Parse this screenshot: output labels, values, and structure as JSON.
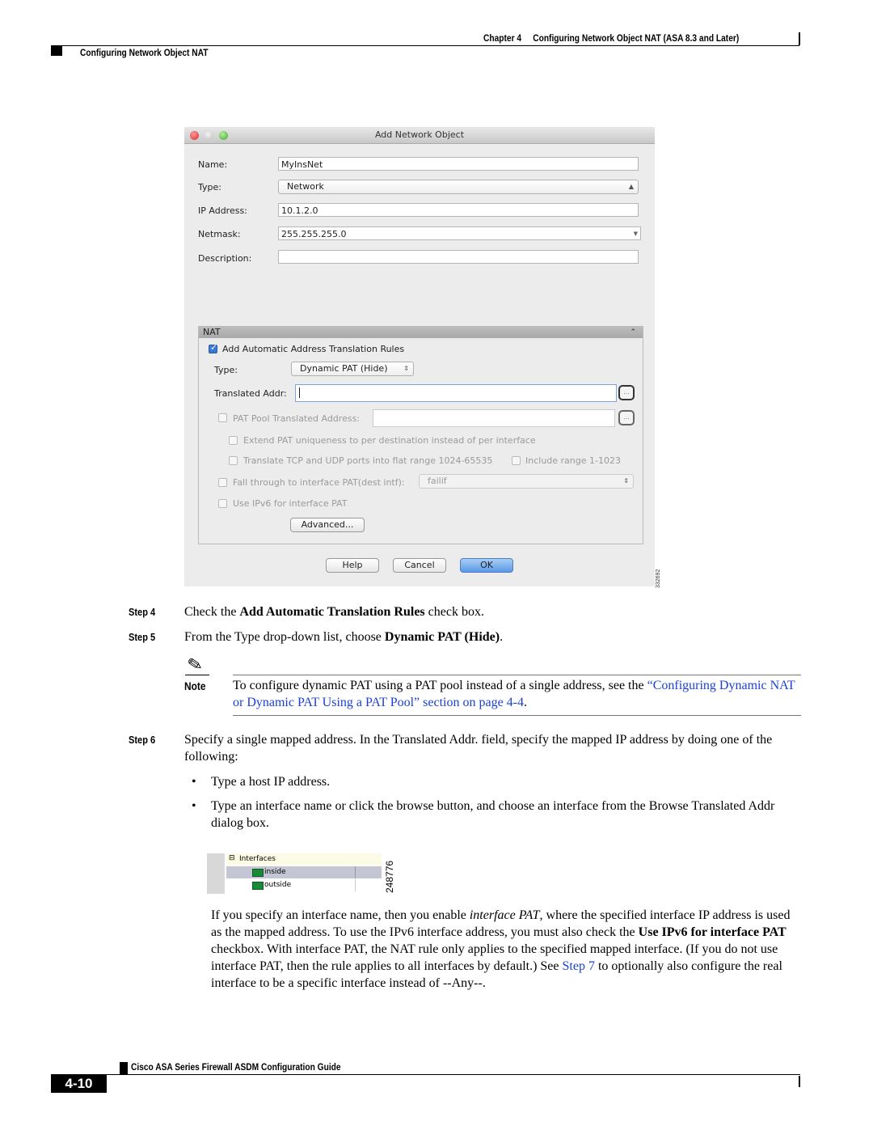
{
  "header": {
    "chapter": "Chapter 4",
    "chapter_title": "Configuring Network Object NAT (ASA 8.3 and Later)",
    "section": "Configuring Network Object NAT"
  },
  "dialog": {
    "title": "Add Network Object",
    "fields": {
      "name_label": "Name:",
      "name_value": "MyInsNet",
      "type_label": "Type:",
      "type_value": "Network",
      "ip_label": "IP Address:",
      "ip_value": "10.1.2.0",
      "netmask_label": "Netmask:",
      "netmask_value": "255.255.255.0",
      "description_label": "Description:",
      "description_value": ""
    },
    "nat": {
      "header": "NAT",
      "collapse_icon": "double-chevron-up",
      "auto_rules_label": "Add Automatic Address Translation Rules",
      "auto_rules_checked": true,
      "type_label": "Type:",
      "type_value": "Dynamic PAT (Hide)",
      "translated_label": "Translated Addr:",
      "translated_value": "",
      "browse_label": "...",
      "pat_pool_label": "PAT Pool Translated Address:",
      "extend_label": "Extend PAT uniqueness to per destination instead of per interface",
      "flat_range_label": "Translate TCP and UDP ports into flat range 1024-65535",
      "include_range_label": "Include range 1-1023",
      "fall_through_label": "Fall through to interface PAT(dest intf):",
      "fall_through_value": "failif",
      "ipv6_label": "Use IPv6 for interface PAT",
      "advanced_button": "Advanced..."
    },
    "buttons": {
      "help": "Help",
      "cancel": "Cancel",
      "ok": "OK"
    },
    "figure_id": "332692"
  },
  "steps": {
    "step4": {
      "label": "Step 4",
      "pre": "Check the ",
      "bold": "Add Automatic Translation Rules",
      "post": " check box."
    },
    "step5": {
      "label": "Step 5",
      "pre": "From the Type drop-down list, choose ",
      "bold": "Dynamic PAT (Hide)",
      "post": "."
    },
    "note": {
      "label": "Note",
      "text": "To configure dynamic PAT using a PAT pool instead of a single address, see the ",
      "link": "“Configuring Dynamic NAT or Dynamic PAT Using a PAT Pool” section on page 4-4",
      "post": "."
    },
    "step6": {
      "label": "Step 6",
      "text": "Specify a single mapped address. In the Translated Addr. field, specify the mapped IP address by doing one of the following:",
      "bullets": [
        "Type a host IP address.",
        "Type an interface name or click the browse button, and choose an interface from the Browse Translated Addr dialog box."
      ]
    },
    "tree": {
      "root": "Interfaces",
      "items": [
        "inside",
        "outside"
      ],
      "figure_id": "248776"
    },
    "para": {
      "t1": "If you specify an interface name, then you enable ",
      "i1": "interface PAT",
      "t2": ", where the specified interface IP address is used as the mapped address. To use the IPv6 interface address, you must also check the ",
      "b1": "Use IPv6 for interface PAT",
      "t3": " checkbox. With interface PAT, the NAT rule only applies to the specified mapped interface. (If you do not use interface PAT, then the rule applies to all interfaces by default.) See ",
      "link": "Step 7",
      "t4": " to optionally also configure the real interface to be a specific interface instead of --Any--."
    }
  },
  "footer": {
    "guide_title": "Cisco ASA Series Firewall ASDM Configuration Guide",
    "page_number": "4-10"
  }
}
